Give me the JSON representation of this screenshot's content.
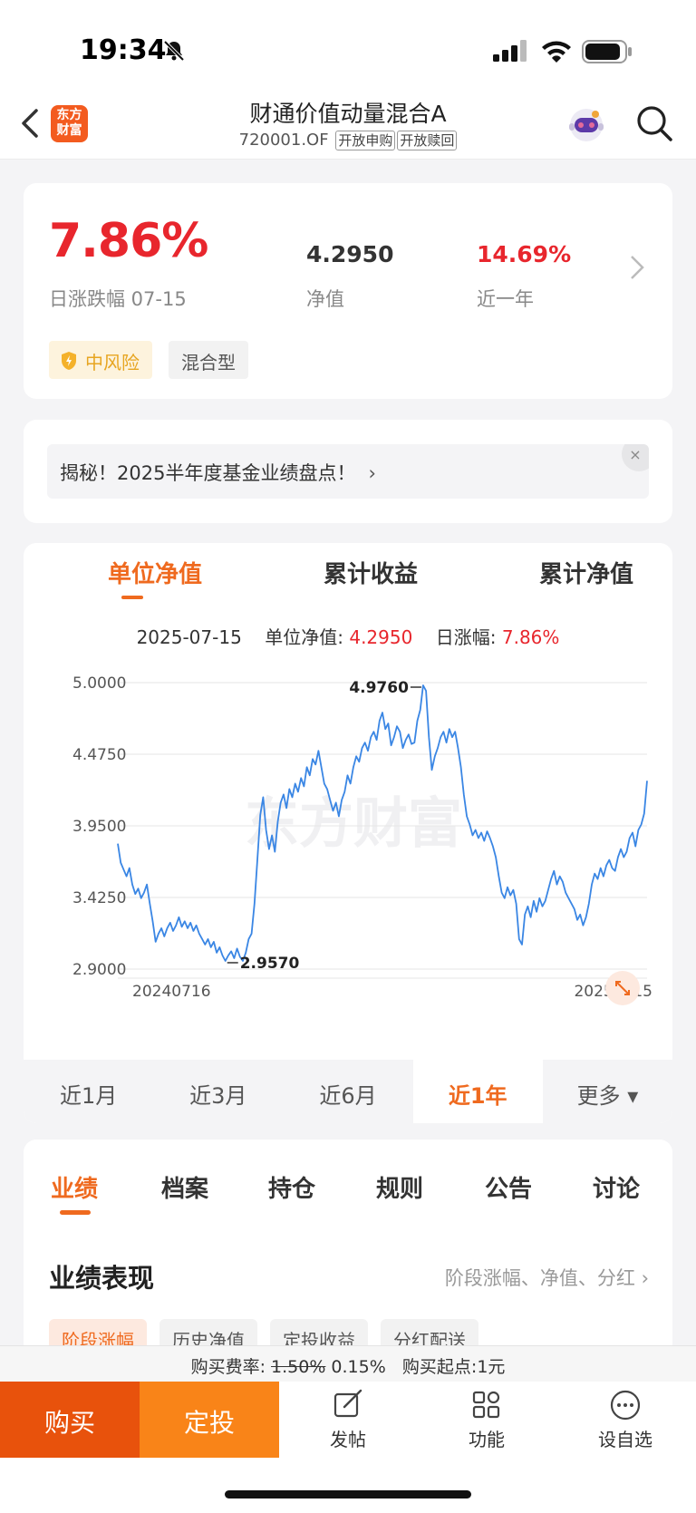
{
  "status_bar": {
    "time": "19:34"
  },
  "header": {
    "title": "财通价值动量混合A",
    "code": "720001.OF",
    "tags": [
      "开放申购",
      "开放赎回"
    ],
    "logo_text": "东方财富"
  },
  "summary": {
    "daily_change": "7.86%",
    "daily_change_label": "日涨跌幅 07-15",
    "nav_value": "4.2950",
    "nav_label": "净值",
    "year_return": "14.69%",
    "year_label": "近一年",
    "risk_tag": "中风险",
    "type_tag": "混合型",
    "accent_red": "#e8262d",
    "risk_color": "#e7a521"
  },
  "banner": {
    "text": "揭秘！2025半年度基金业绩盘点！",
    "close": "×"
  },
  "chart_tabs": [
    "单位净值",
    "累计收益",
    "累计净值"
  ],
  "chart_info": {
    "date": "2025-07-15",
    "nav_label": "单位净值: ",
    "nav_value": "4.2950",
    "change_label": "日涨幅: ",
    "change_value": "7.86%"
  },
  "chart_data": {
    "type": "line",
    "watermark": "东方财富",
    "x_start_label": "20240716",
    "x_end_label": "20250715",
    "ylim": [
      2.9,
      5.0
    ],
    "yticks": [
      "5.0000",
      "4.4750",
      "3.9500",
      "3.4250",
      "2.9000"
    ],
    "max_label": "4.9760",
    "min_label": "2.9570",
    "line_color": "#3a86e4",
    "series": [
      {
        "values": [
          3.82,
          3.68,
          3.63,
          3.58,
          3.64,
          3.52,
          3.45,
          3.49,
          3.42,
          3.46,
          3.52,
          3.38,
          3.25,
          3.1,
          3.16,
          3.2,
          3.14,
          3.2,
          3.24,
          3.18,
          3.22,
          3.28,
          3.21,
          3.25,
          3.2,
          3.24,
          3.18,
          3.22,
          3.16,
          3.12,
          3.08,
          3.12,
          3.06,
          3.1,
          3.02,
          3.06,
          3.0,
          2.96,
          3.0,
          3.03,
          2.98,
          3.05,
          2.99,
          2.96,
          3.02,
          3.12,
          3.16,
          3.38,
          3.7,
          4.03,
          4.16,
          3.92,
          3.78,
          3.88,
          3.76,
          3.98,
          4.12,
          4.18,
          4.08,
          4.22,
          4.16,
          4.26,
          4.2,
          4.3,
          4.24,
          4.38,
          4.32,
          4.44,
          4.4,
          4.5,
          4.38,
          4.26,
          4.22,
          4.14,
          4.06,
          4.12,
          4.02,
          4.14,
          4.2,
          4.32,
          4.26,
          4.38,
          4.46,
          4.42,
          4.52,
          4.56,
          4.5,
          4.6,
          4.64,
          4.58,
          4.72,
          4.78,
          4.66,
          4.7,
          4.54,
          4.6,
          4.68,
          4.64,
          4.52,
          4.58,
          4.62,
          4.55,
          4.56,
          4.72,
          4.8,
          4.98,
          4.94,
          4.6,
          4.36,
          4.46,
          4.52,
          4.6,
          4.64,
          4.56,
          4.66,
          4.6,
          4.64,
          4.52,
          4.38,
          4.18,
          4.02,
          3.96,
          3.88,
          3.92,
          3.86,
          3.9,
          3.84,
          3.91,
          3.86,
          3.8,
          3.72,
          3.58,
          3.46,
          3.42,
          3.5,
          3.44,
          3.48,
          3.38,
          3.12,
          3.08,
          3.3,
          3.36,
          3.28,
          3.4,
          3.32,
          3.42,
          3.36,
          3.4,
          3.48,
          3.56,
          3.62,
          3.52,
          3.58,
          3.54,
          3.46,
          3.42,
          3.38,
          3.34,
          3.26,
          3.3,
          3.22,
          3.28,
          3.38,
          3.52,
          3.6,
          3.56,
          3.64,
          3.58,
          3.66,
          3.7,
          3.64,
          3.62,
          3.72,
          3.78,
          3.72,
          3.76,
          3.86,
          3.9,
          3.8,
          3.92,
          3.96,
          4.04,
          4.28
        ]
      }
    ]
  },
  "periods": [
    "近1月",
    "近3月",
    "近6月",
    "近1年",
    "更多 ▾"
  ],
  "perf_tabs": [
    "业绩",
    "档案",
    "持仓",
    "规则",
    "公告",
    "讨论"
  ],
  "perf_section": {
    "title": "业绩表现",
    "link": "阶段涨幅、净值、分红 ›",
    "chips": [
      "阶段涨幅",
      "历史净值",
      "定投收益",
      "分红配送"
    ]
  },
  "fee_bar": {
    "label": "购买费率: ",
    "old_fee": "1.50%",
    "new_fee": " 0.15%",
    "min_label": "   购买起点:1元"
  },
  "bottom_bar": {
    "buy": "购买",
    "plan": "定投",
    "post": "发帖",
    "function": "功能",
    "watchlist": "设自选"
  }
}
